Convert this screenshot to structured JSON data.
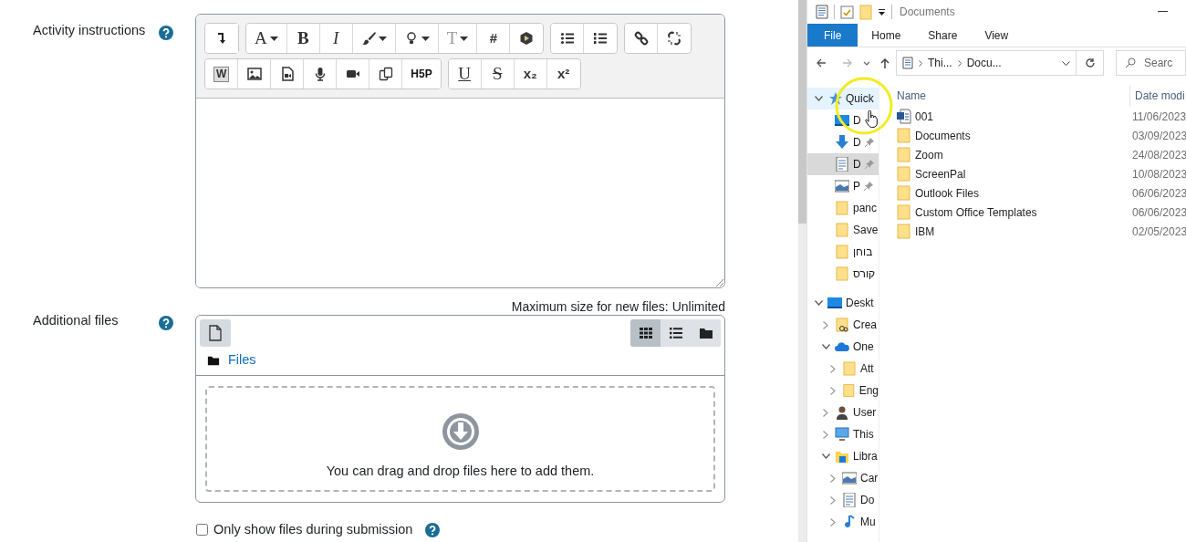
{
  "form": {
    "instructions": {
      "label": "Activity instructions",
      "help": true,
      "toolbar": [
        [
          [
            {
              "kind": "collapse"
            }
          ],
          [
            {
              "kind": "font",
              "text": "A",
              "dropdown": true
            },
            {
              "kind": "bold",
              "text": "B"
            },
            {
              "kind": "italic",
              "text": "I"
            },
            {
              "kind": "brush",
              "dropdown": true
            },
            {
              "kind": "bulb",
              "dropdown": true
            },
            {
              "kind": "fontsize",
              "text": "T",
              "dropdown": true
            },
            {
              "kind": "text",
              "text": "#"
            },
            {
              "kind": "cube"
            }
          ],
          [
            {
              "kind": "bullets"
            },
            {
              "kind": "numbers"
            }
          ],
          [
            {
              "kind": "link"
            },
            {
              "kind": "unlink"
            }
          ]
        ],
        [
          [
            {
              "kind": "word",
              "text": "W"
            },
            {
              "kind": "image"
            },
            {
              "kind": "videofile"
            },
            {
              "kind": "mic"
            },
            {
              "kind": "camera"
            },
            {
              "kind": "copy"
            },
            {
              "kind": "logo",
              "text": "H5P"
            }
          ],
          [
            {
              "kind": "underline",
              "text": "U"
            },
            {
              "kind": "strike",
              "text": "S"
            },
            {
              "kind": "text",
              "text": "x₂"
            },
            {
              "kind": "text",
              "text": "x²"
            }
          ]
        ]
      ]
    },
    "files": {
      "label": "Additional files",
      "help": true,
      "max_size": "Maximum size for new files: Unlimited",
      "views": [
        {
          "kind": "grid",
          "selected": true
        },
        {
          "kind": "list",
          "selected": false
        },
        {
          "kind": "tree",
          "selected": false
        }
      ],
      "path": "Files",
      "drop_text": "You can drag and drop files here to add them."
    },
    "submission_only": {
      "label": "Only show files during submission",
      "checked": false,
      "help": true
    }
  },
  "explorer": {
    "title": "Documents",
    "ribbon_tabs": [
      {
        "label": "File",
        "selected": true
      },
      {
        "label": "Home",
        "selected": false
      },
      {
        "label": "Share",
        "selected": false
      },
      {
        "label": "View",
        "selected": false
      }
    ],
    "address": [
      "Thi...",
      "Docu..."
    ],
    "search": {
      "placeholder": "Searc"
    },
    "nav_tree": [
      {
        "label": "Quick",
        "kind": "star",
        "expanded": true,
        "selected": false,
        "hovered": true,
        "children": [
          {
            "label": "D",
            "kind": "desktop",
            "pinned": false,
            "selected": false
          },
          {
            "label": "D",
            "kind": "download",
            "pinned": true,
            "selected": false
          },
          {
            "label": "D",
            "kind": "document",
            "pinned": true,
            "selected": true
          },
          {
            "label": "P",
            "kind": "picture",
            "pinned": true,
            "selected": false
          },
          {
            "label": "panc",
            "kind": "folder",
            "pinned": false,
            "selected": false
          },
          {
            "label": "Save",
            "kind": "folder",
            "pinned": false,
            "selected": false
          },
          {
            "label": "בוחן",
            "kind": "folder",
            "pinned": false,
            "selected": false
          },
          {
            "label": "קורס",
            "kind": "folder",
            "pinned": false,
            "selected": false
          }
        ]
      },
      {
        "label": "Deskt",
        "kind": "desktop",
        "expanded": true,
        "selected": false,
        "children": [
          {
            "label": "Crea",
            "kind": "shared",
            "expanded": false,
            "selected": false
          },
          {
            "label": "One",
            "kind": "cloud",
            "expanded": true,
            "selected": false,
            "children": [
              {
                "label": "Att",
                "kind": "folder",
                "expanded": false,
                "selected": false
              },
              {
                "label": "Eng",
                "kind": "folder",
                "expanded": false,
                "selected": false
              }
            ]
          },
          {
            "label": "User",
            "kind": "user",
            "expanded": false,
            "selected": false
          },
          {
            "label": "This",
            "kind": "computer",
            "expanded": false,
            "selected": false
          },
          {
            "label": "Libra",
            "kind": "library",
            "expanded": true,
            "selected": false,
            "children": [
              {
                "label": "Car",
                "kind": "picture",
                "expanded": false,
                "selected": false
              },
              {
                "label": "Do",
                "kind": "document",
                "expanded": false,
                "selected": false
              },
              {
                "label": "Mu",
                "kind": "music",
                "expanded": false,
                "selected": false
              }
            ]
          }
        ]
      }
    ],
    "columns": [
      "Name",
      "Date modi"
    ],
    "files": [
      {
        "name": "001",
        "kind": "word",
        "date": "11/06/2023"
      },
      {
        "name": "Documents",
        "kind": "folder",
        "date": "03/09/2023"
      },
      {
        "name": "Zoom",
        "kind": "folder",
        "date": "24/08/2023"
      },
      {
        "name": "ScreenPal",
        "kind": "folder",
        "date": "10/08/2023"
      },
      {
        "name": "Outlook Files",
        "kind": "folder",
        "date": "06/06/2023"
      },
      {
        "name": "Custom Office Templates",
        "kind": "folder",
        "date": "06/06/2023"
      },
      {
        "name": "IBM",
        "kind": "folder",
        "date": "02/05/2023"
      }
    ]
  }
}
